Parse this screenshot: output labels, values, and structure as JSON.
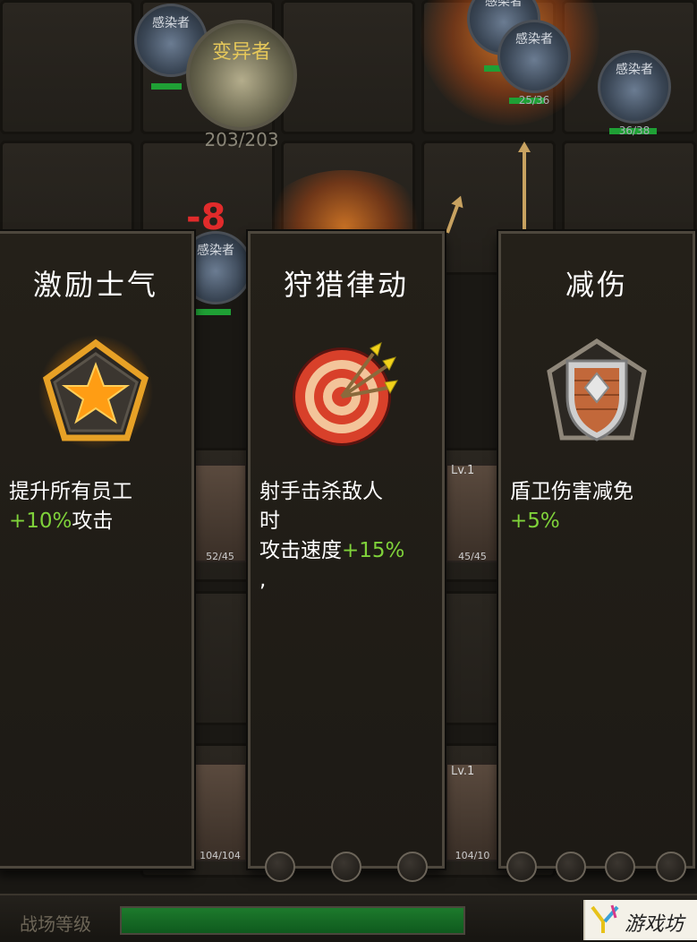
{
  "battlefield": {
    "enemies": [
      {
        "name": "感染者",
        "hp": "",
        "hp_fraction": 0.6
      },
      {
        "name": "变异者",
        "hp": "203/203",
        "hp_fraction": 1.0
      },
      {
        "name": "感染者",
        "hp": "",
        "hp_fraction": 0.5
      },
      {
        "name": "感染者",
        "hp": "25/36",
        "hp_fraction": 0.69
      },
      {
        "name": "感染者",
        "hp": "36/38",
        "hp_fraction": 0.95
      },
      {
        "name": "感染者",
        "hp": "",
        "hp_fraction": 0.8
      }
    ],
    "damage_text": "-8",
    "units": [
      {
        "level": "",
        "hp": "52/45"
      },
      {
        "level": "Lv.1",
        "hp": "45/45"
      },
      {
        "level": "",
        "hp": "104/104"
      },
      {
        "level": "Lv.1",
        "hp": "104/10"
      }
    ]
  },
  "cards": [
    {
      "title": "激励士气",
      "icon": "star-badge-icon",
      "desc_lines": [
        "提升所有员工"
      ],
      "bonus": "+10%",
      "bonus_suffix": "攻击"
    },
    {
      "title": "狩猎律动",
      "icon": "target-arrows-icon",
      "desc_lines": [
        "射手击杀敌人",
        "时"
      ],
      "prefix": "攻击速度",
      "bonus": "+15%",
      "trailing": ","
    },
    {
      "title": "减伤",
      "icon": "shield-icon",
      "desc_lines": [
        "盾卫伤害减免"
      ],
      "bonus": "+5%"
    }
  ],
  "bottom_bar": {
    "label": "战场等级",
    "progress_fraction": 1.0
  },
  "watermark": {
    "text": "游戏坊",
    "icon": "y-logo-icon"
  },
  "colors": {
    "bonus": "#7fd23a",
    "damage": "#e12b2b",
    "progress": "#1d7a2c"
  }
}
